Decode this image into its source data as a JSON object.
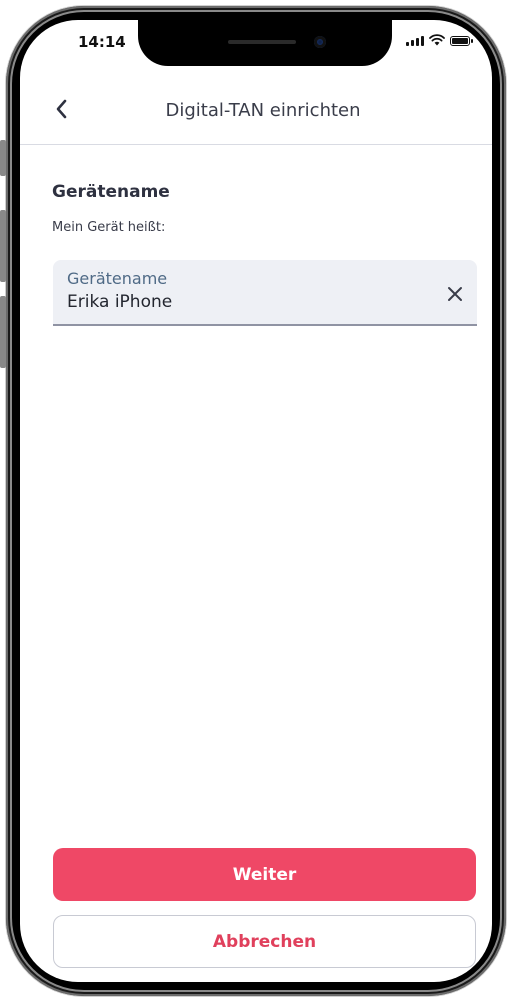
{
  "status_bar": {
    "time": "14:14",
    "icons": [
      "signal-icon",
      "wifi-icon",
      "battery-icon"
    ]
  },
  "header": {
    "back_icon": "chevron-left-icon",
    "title": "Digital-TAN einrichten"
  },
  "main": {
    "section_title": "Gerätename",
    "section_subtitle": "Mein Gerät heißt:",
    "device_field": {
      "label": "Gerätename",
      "value": "Erika iPhone",
      "clear_icon": "close-icon"
    }
  },
  "actions": {
    "primary_label": "Weiter",
    "secondary_label": "Abbrechen"
  },
  "colors": {
    "accent": "#ef4866",
    "secondary_text": "#e0405c",
    "field_background": "#eef0f5",
    "field_label": "#4f6a86"
  }
}
